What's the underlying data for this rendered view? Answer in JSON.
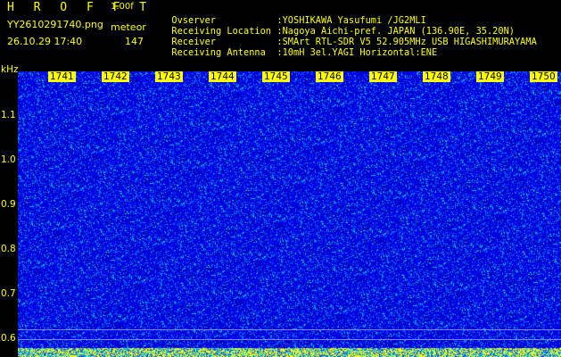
{
  "header": {
    "title": "H R O F F T",
    "version": "1.00f",
    "file": "YY2610291740.png",
    "datetime": "26.10.29 17:40",
    "mode": "meteor",
    "count": "147"
  },
  "info": [
    {
      "label": "Ovserver",
      "value": ":YOSHIKAWA Yasufumi /JG2MLI"
    },
    {
      "label": "Receiving Location",
      "value": ":Nagoya Aichi-pref. JAPAN (136.90E, 35.20N)"
    },
    {
      "label": "Receiver",
      "value": ":SMArt RTL-SDR V5 52.905MHz USB HIGASHIMURAYAMA"
    },
    {
      "label": "Receiving Antenna",
      "value": ":10mH 3el.YAGI Horizontal:ENE"
    }
  ],
  "axis": {
    "unit": "kHz",
    "y_ticks": [
      "1.1",
      "1.0",
      "0.9",
      "0.8",
      "0.7",
      "0.6"
    ],
    "x_ticks": [
      "1741",
      "1742",
      "1743",
      "1744",
      "1745",
      "1746",
      "1747",
      "1748",
      "1749",
      "1750"
    ]
  },
  "colors": {
    "text": "#ffff00",
    "background": "#000000",
    "plot_base": "#0000ff",
    "noise_cyan": "#00d0ff"
  }
}
